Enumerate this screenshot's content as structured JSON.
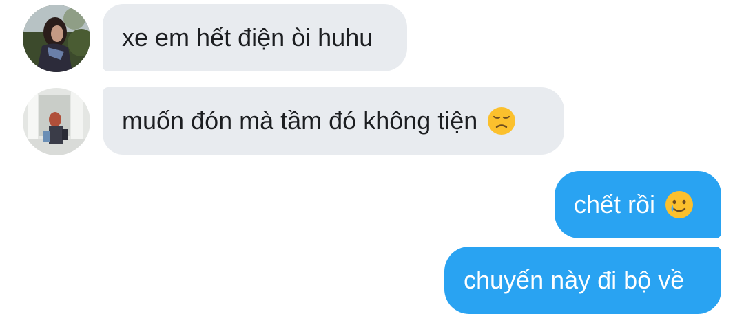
{
  "messages": [
    {
      "direction": "incoming",
      "text": "xe em hết điện òi huhu",
      "avatar": "contact-avatar-1"
    },
    {
      "direction": "incoming",
      "text": "muốn đón mà tầm đó không tiện",
      "emoji": "disappointed-face-icon",
      "avatar": "contact-avatar-2"
    },
    {
      "direction": "outgoing",
      "text": "chết rồi",
      "emoji": "smiling-face-with-tear-icon"
    },
    {
      "direction": "outgoing",
      "text": "chuyến này đi bộ về"
    }
  ],
  "colors": {
    "incoming_bubble": "#e8ebef",
    "incoming_text": "#1c1e21",
    "outgoing_bubble": "#29a3f2",
    "outgoing_text": "#ffffff",
    "emoji_face": "#fbc02d",
    "emoji_tear": "#4fa9e8"
  }
}
